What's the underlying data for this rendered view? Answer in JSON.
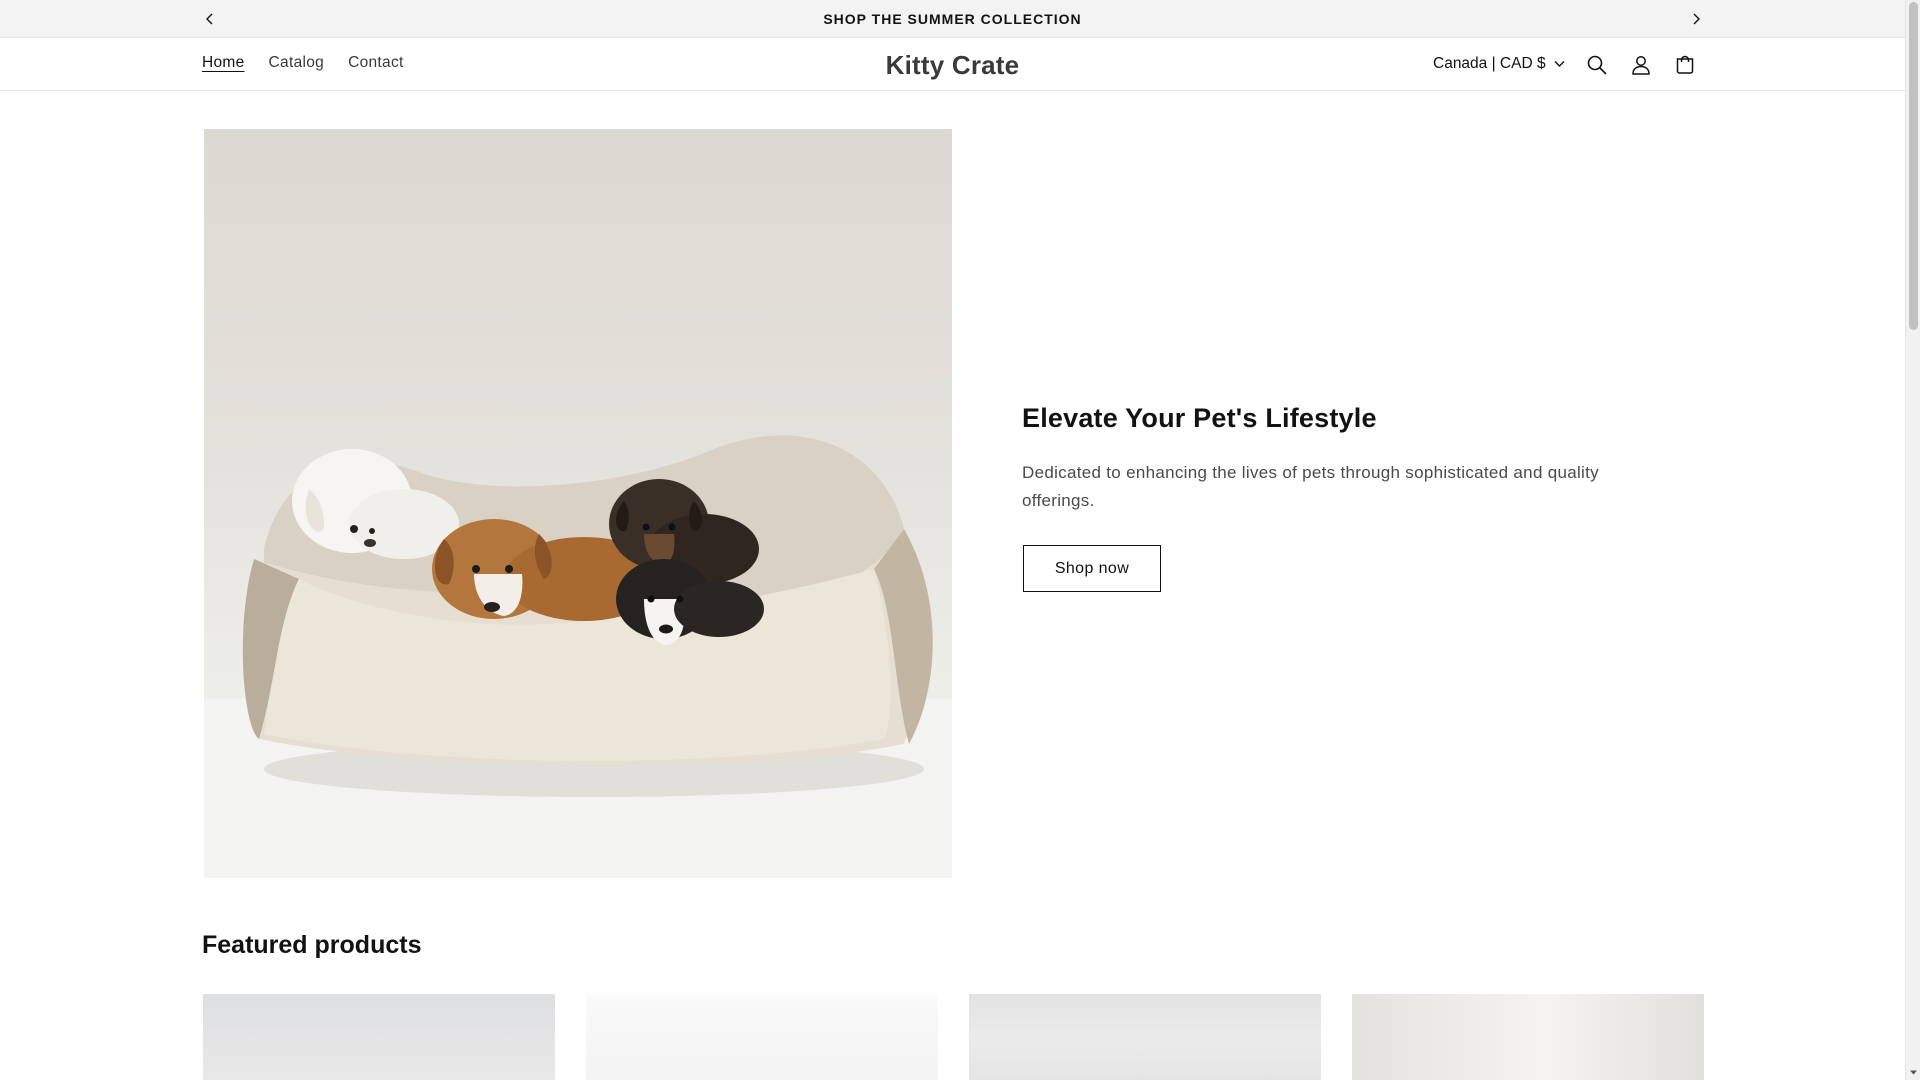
{
  "announcement": {
    "text": "SHOP THE SUMMER COLLECTION",
    "prev_icon": "chevron-left-icon",
    "next_icon": "chevron-right-icon"
  },
  "header": {
    "nav": [
      {
        "label": "Home",
        "active": true
      },
      {
        "label": "Catalog",
        "active": false
      },
      {
        "label": "Contact",
        "active": false
      }
    ],
    "logo": "Kitty Crate",
    "locale": "Canada | CAD $",
    "icons": [
      "search-icon",
      "account-icon",
      "cart-icon"
    ]
  },
  "hero": {
    "image": "puppies-in-pet-bed",
    "title": "Elevate Your Pet's Lifestyle",
    "text": "Dedicated to enhancing the lives of pets through sophisticated and quality offerings.",
    "button": "Shop now"
  },
  "featured": {
    "title": "Featured products",
    "products": [
      {
        "image": "product-image-1"
      },
      {
        "image": "product-image-2"
      },
      {
        "image": "product-image-3"
      },
      {
        "image": "product-image-4"
      }
    ]
  },
  "colors": {
    "text": "#121212",
    "announcement_bg": "#f3f3f3",
    "border": "#e6e6e6"
  }
}
